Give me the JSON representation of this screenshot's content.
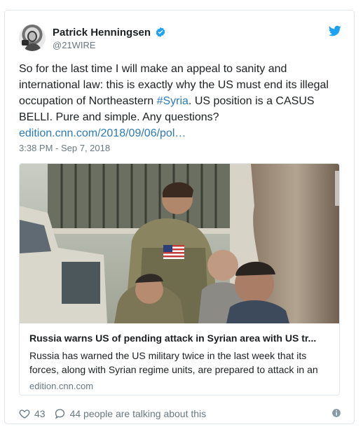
{
  "author": {
    "name": "Patrick Henningsen",
    "handle": "@21WIRE"
  },
  "tweet": {
    "text_main": "So for the last time I will make an appeal to sanity and international law: this is exactly why the US must end its illegal occupation of Northeastern ",
    "hashtag": "#Syria",
    "text_after_hashtag": ". US position is a CASUS BELLI. Pure and simple. Any questions? ",
    "link_text": "edition.cnn.com/2018/09/06/pol…",
    "timestamp": "3:38 PM - Sep 7, 2018"
  },
  "card": {
    "title": "Russia warns US of pending attack in Syrian area with US tr...",
    "description": "Russia has warned the US military twice in the last week that its forces, along with Syrian regime units, are prepared to attack in an",
    "domain": "edition.cnn.com"
  },
  "engagement": {
    "likes": "43",
    "talking": "44 people are talking about this"
  },
  "icons": {
    "verified": "verified-badge-icon",
    "brand": "twitter-bird-icon",
    "like": "heart-icon",
    "reply": "speech-bubble-icon",
    "info": "info-icon"
  },
  "colors": {
    "brand_blue": "#1da1f2",
    "link_blue": "#2b7bb9",
    "muted": "#697882",
    "text": "#1c2022",
    "border": "#e1e8ed"
  }
}
